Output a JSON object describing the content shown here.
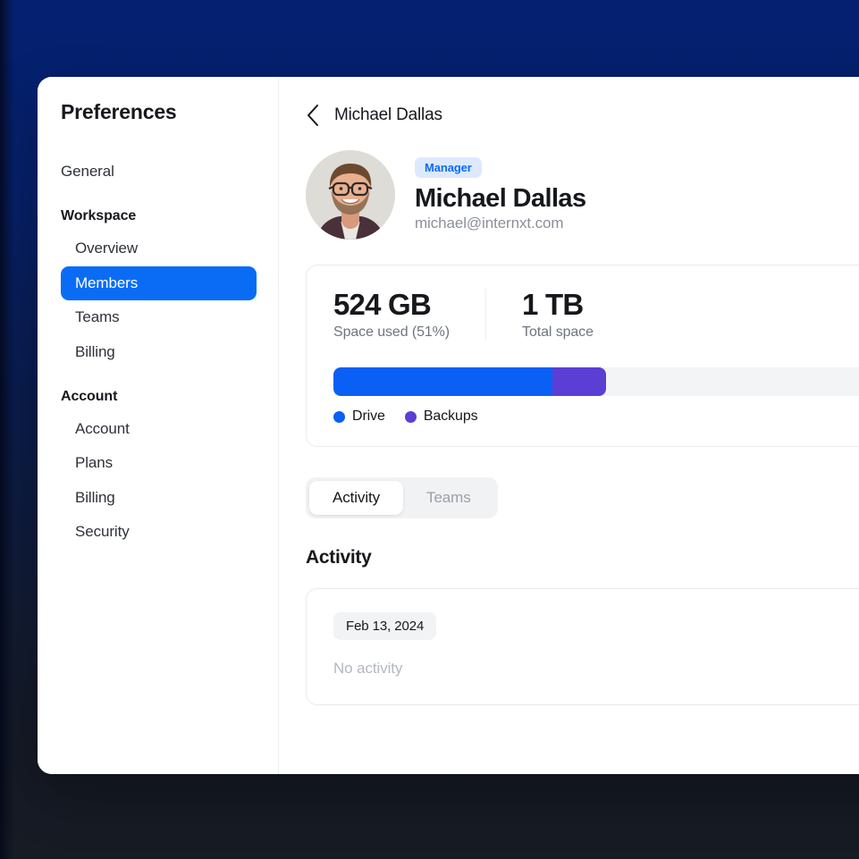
{
  "sidebar": {
    "title": "Preferences",
    "items": [
      {
        "label": "General",
        "type": "item",
        "active": false
      },
      {
        "label": "Workspace",
        "type": "group"
      },
      {
        "label": "Overview",
        "type": "item",
        "active": false
      },
      {
        "label": "Members",
        "type": "item",
        "active": true
      },
      {
        "label": "Teams",
        "type": "item",
        "active": false
      },
      {
        "label": "Billing",
        "type": "item",
        "active": false
      },
      {
        "label": "Account",
        "type": "group"
      },
      {
        "label": "Account",
        "type": "item",
        "active": false
      },
      {
        "label": "Plans",
        "type": "item",
        "active": false
      },
      {
        "label": "Billing",
        "type": "item",
        "active": false
      },
      {
        "label": "Security",
        "type": "item",
        "active": false
      }
    ],
    "active_color": "#0a6cf5"
  },
  "topbar": {
    "back_icon": "chevron-left-icon",
    "title": "Michael Dallas"
  },
  "profile": {
    "avatar_alt": "Michael Dallas profile photo",
    "badge": "Manager",
    "badge_bg": "#dde9ff",
    "badge_color": "#0a6cf5",
    "name": "Michael Dallas",
    "email": "michael@internxt.com"
  },
  "storage": {
    "used_value": "524 GB",
    "used_label": "Space used (51%)",
    "total_value": "1 TB",
    "total_label": "Total space",
    "used_percent": 51,
    "segments": [
      {
        "name": "Drive",
        "percent": 41,
        "color": "#0a60f4"
      },
      {
        "name": "Backups",
        "percent": 10,
        "color": "#5b3fd4"
      }
    ],
    "legend": [
      {
        "label": "Drive",
        "color": "#0a60f4"
      },
      {
        "label": "Backups",
        "color": "#5b3fd4"
      }
    ]
  },
  "tabs": [
    {
      "label": "Activity",
      "active": true
    },
    {
      "label": "Teams",
      "active": false
    }
  ],
  "activity": {
    "section_title": "Activity",
    "date": "Feb 13, 2024",
    "empty": "No activity"
  }
}
